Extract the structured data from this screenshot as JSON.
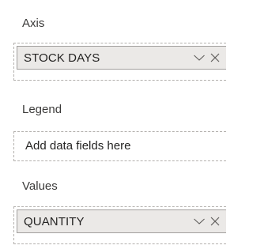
{
  "axis": {
    "label": "Axis",
    "field": "STOCK DAYS"
  },
  "legend": {
    "label": "Legend",
    "placeholder": "Add data fields here"
  },
  "values": {
    "label": "Values",
    "field": "QUANTITY"
  },
  "icons": {
    "dropdown": "chevron-down-icon",
    "remove": "close-icon"
  }
}
